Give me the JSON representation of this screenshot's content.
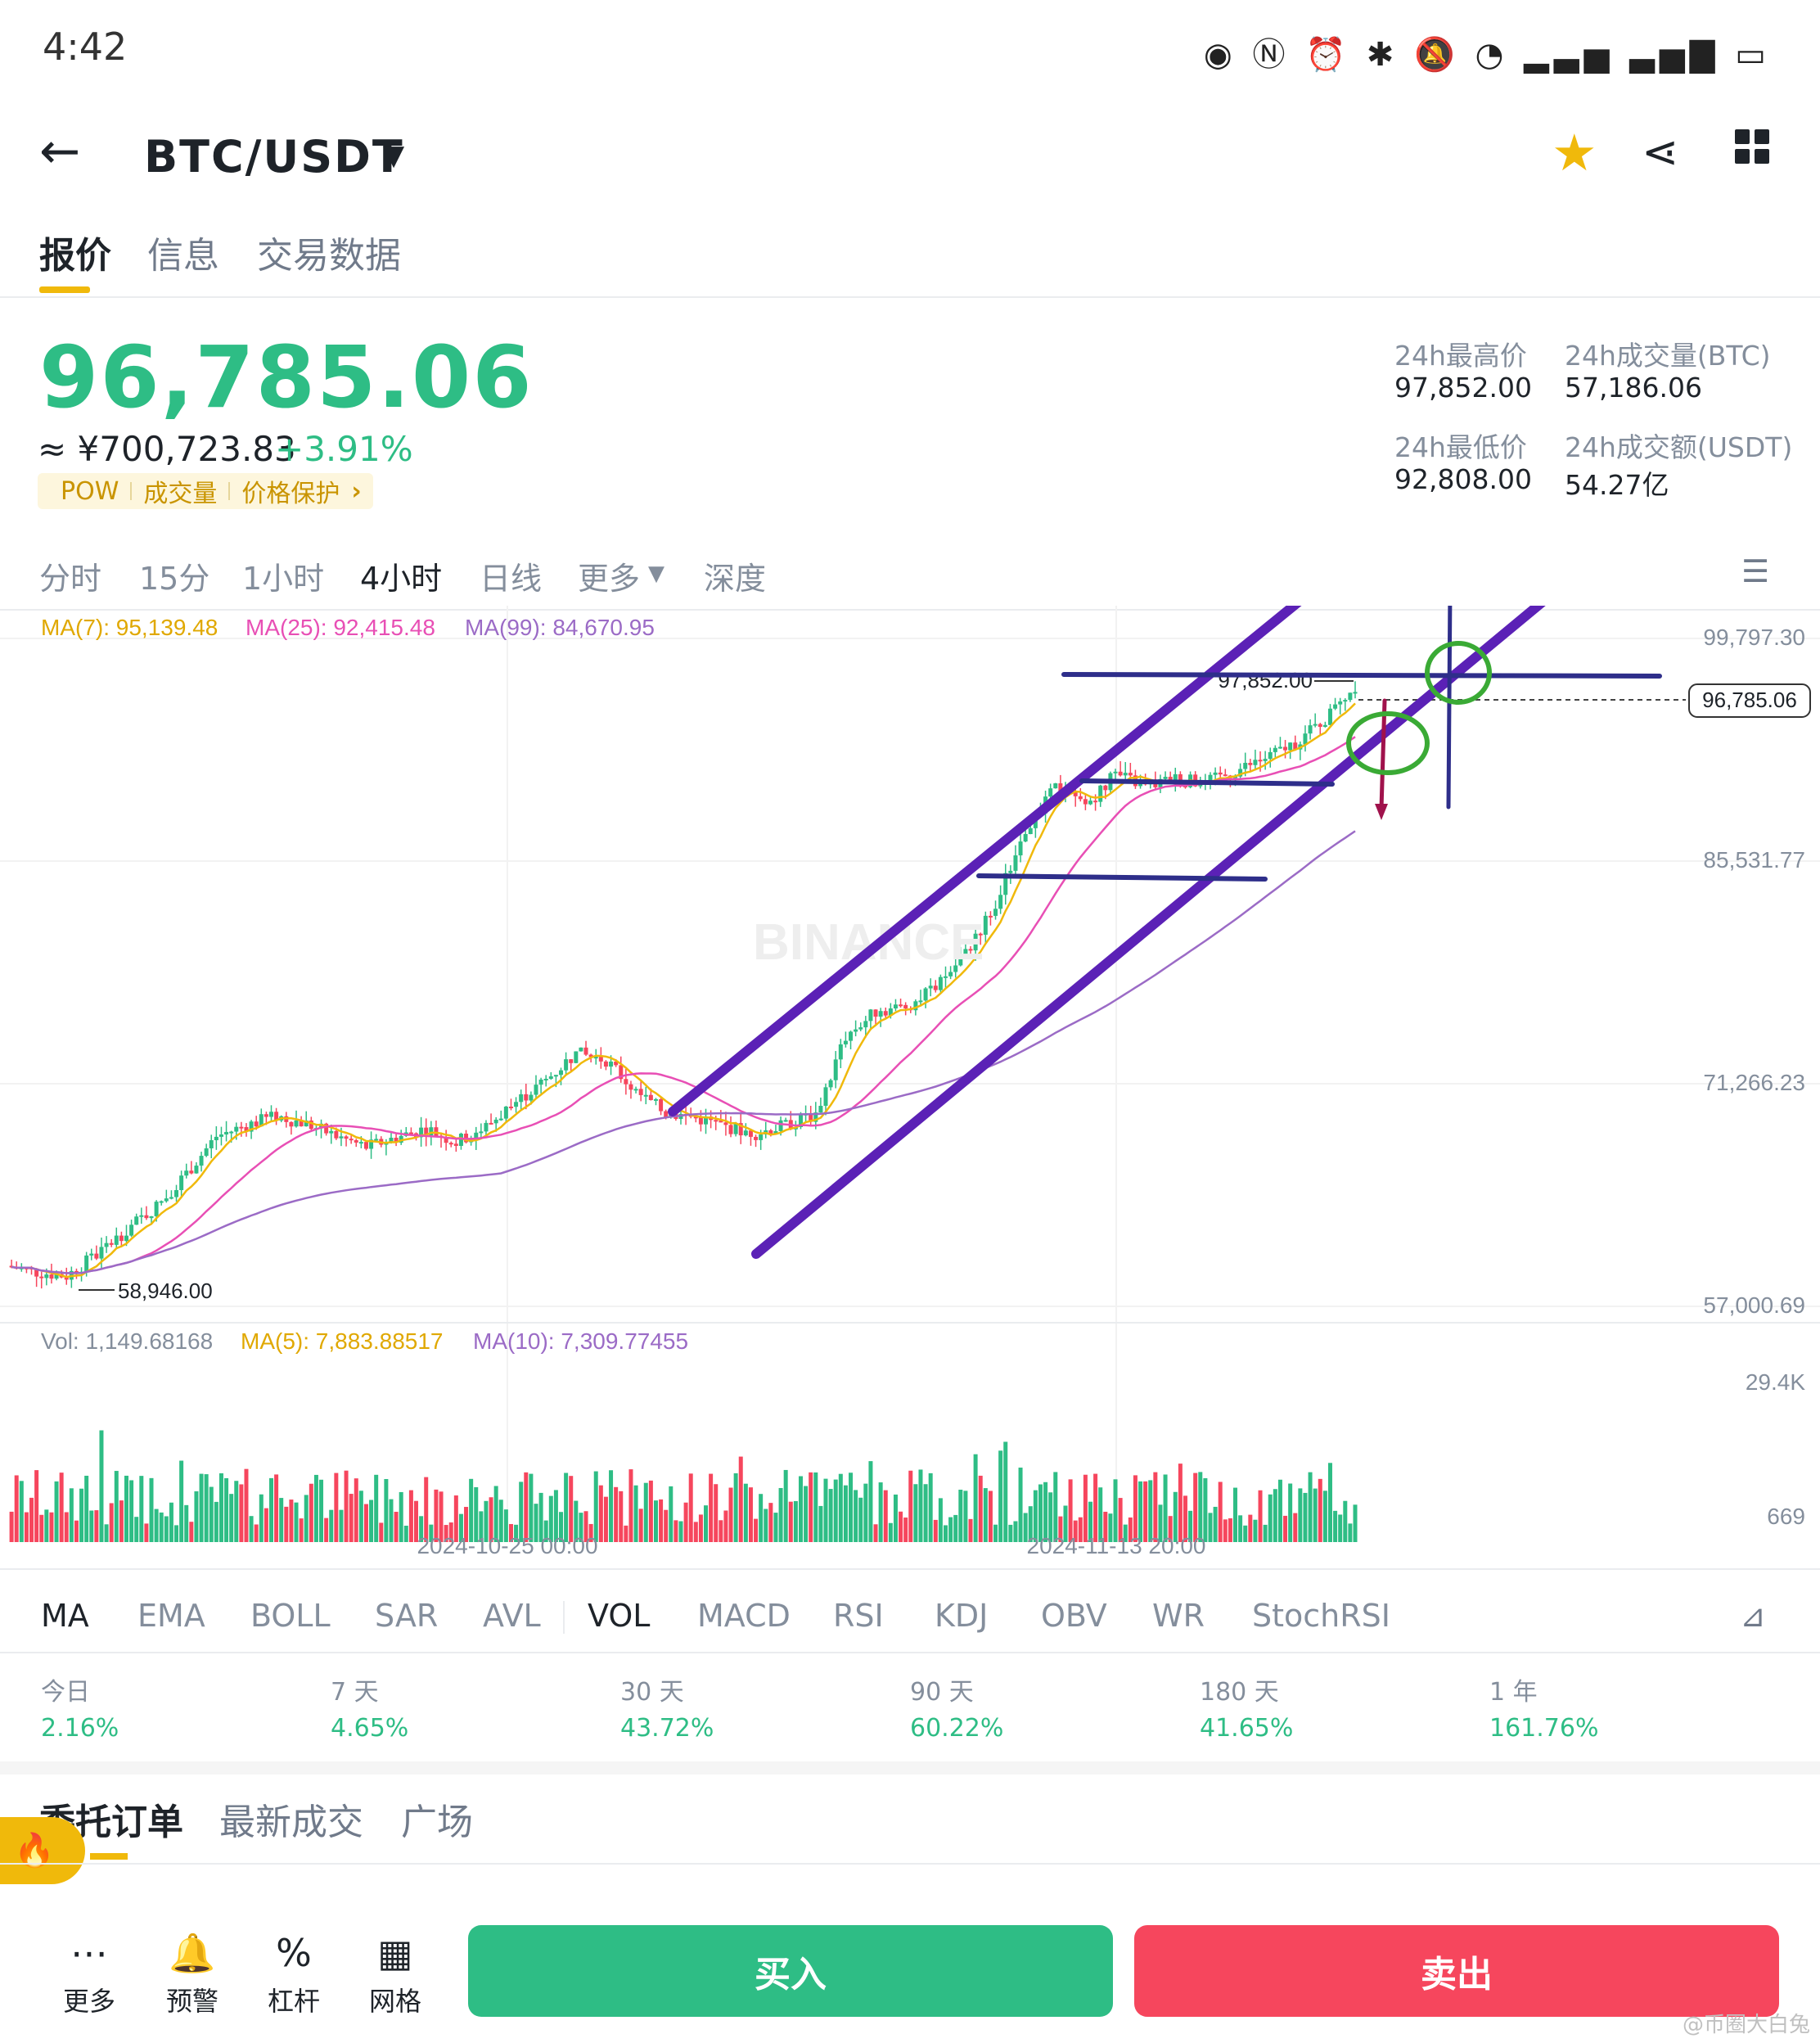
{
  "status_bar": {
    "time": "4:42",
    "icons": [
      "eye-icon",
      "nfc-icon",
      "alarm-icon",
      "bluetooth-icon",
      "mute-icon",
      "wifi-icon",
      "signal-icon",
      "signal-4g-icon",
      "battery-icon"
    ]
  },
  "header": {
    "pair": "BTC/USDT"
  },
  "tabs": [
    "报价",
    "信息",
    "交易数据"
  ],
  "price": {
    "last": "96,785.06",
    "cny": "≈ ¥700,723.83",
    "change": "+3.91%",
    "tags": [
      "POW",
      "成交量",
      "价格保护"
    ]
  },
  "stats": {
    "high_label": "24h最高价",
    "high": "97,852.00",
    "low_label": "24h最低价",
    "low": "92,808.00",
    "vol_btc_label": "24h成交量(BTC)",
    "vol_btc": "57,186.06",
    "vol_usdt_label": "24h成交额(USDT)",
    "vol_usdt": "54.27亿"
  },
  "intervals": [
    "分时",
    "15分",
    "1小时",
    "4小时",
    "日线",
    "更多",
    "深度"
  ],
  "active_interval": "4小时",
  "ma_legend": {
    "ma7": "MA(7): 95,139.48",
    "ma25": "MA(25): 92,415.48",
    "ma99": "MA(99): 84,670.95"
  },
  "vol_legend": {
    "vol": "Vol: 1,149.68168",
    "ma5": "MA(5): 7,883.88517",
    "ma10": "MA(10): 7,309.77455"
  },
  "chart_labels": {
    "high_marker": "97,852.00",
    "low_marker": "58,946.00",
    "current_tag": "96,785.06",
    "watermark": "BINANCE",
    "date_left": "2024-10-25 00:00",
    "date_right": "2024-11-13 20:00"
  },
  "chart_data": {
    "type": "candlestick",
    "y_ticks": [
      "99,797.30",
      "85,531.77",
      "71,266.23",
      "57,000.69"
    ],
    "ylim": [
      57000.69,
      99797.3
    ],
    "vol_ticks": [
      "29.4K",
      "669"
    ],
    "x_ticks": [
      "2024-10-25 00:00",
      "2024-11-13 20:00"
    ],
    "close_approx": [
      59600,
      59200,
      58946,
      60300,
      61900,
      63400,
      65500,
      67900,
      68600,
      69200,
      68700,
      67900,
      67200,
      67800,
      68400,
      67500,
      68500,
      70100,
      71500,
      73200,
      72800,
      70700,
      69400,
      69100,
      68500,
      68100,
      68600,
      69300,
      74300,
      75900,
      76200,
      77400,
      79600,
      82800,
      87500,
      90200,
      89100,
      91100,
      90300,
      90800,
      90500,
      91300,
      92100,
      93100,
      94600,
      96785
    ],
    "indicators": {
      "ma7": 95139.48,
      "ma25": 92415.48,
      "ma99": 84670.95
    },
    "colors": {
      "up": "#2ebd85",
      "down": "#f6465d",
      "ma7": "#f0b90b",
      "ma25": "#e84fb5",
      "ma99": "#9b6bc6",
      "drawing": "#5b21b6"
    }
  },
  "indicator_tabs": [
    "MA",
    "EMA",
    "BOLL",
    "SAR",
    "AVL",
    "VOL",
    "MACD",
    "RSI",
    "KDJ",
    "OBV",
    "WR",
    "StochRSI"
  ],
  "performance": [
    {
      "label": "今日",
      "value": "2.16%"
    },
    {
      "label": "7 天",
      "value": "4.65%"
    },
    {
      "label": "30 天",
      "value": "43.72%"
    },
    {
      "label": "90 天",
      "value": "60.22%"
    },
    {
      "label": "180 天",
      "value": "41.65%"
    },
    {
      "label": "1 年",
      "value": "161.76%"
    }
  ],
  "order_tabs": [
    "委托订单",
    "最新成交",
    "广场"
  ],
  "bottom_nav": [
    {
      "label": "更多",
      "icon": "more-icon"
    },
    {
      "label": "预警",
      "icon": "bell-icon"
    },
    {
      "label": "杠杆",
      "icon": "leverage-icon"
    },
    {
      "label": "网格",
      "icon": "grid-trading-icon"
    }
  ],
  "buy_label": "买入",
  "sell_label": "卖出",
  "corner_watermark": "@币圈大白兔"
}
